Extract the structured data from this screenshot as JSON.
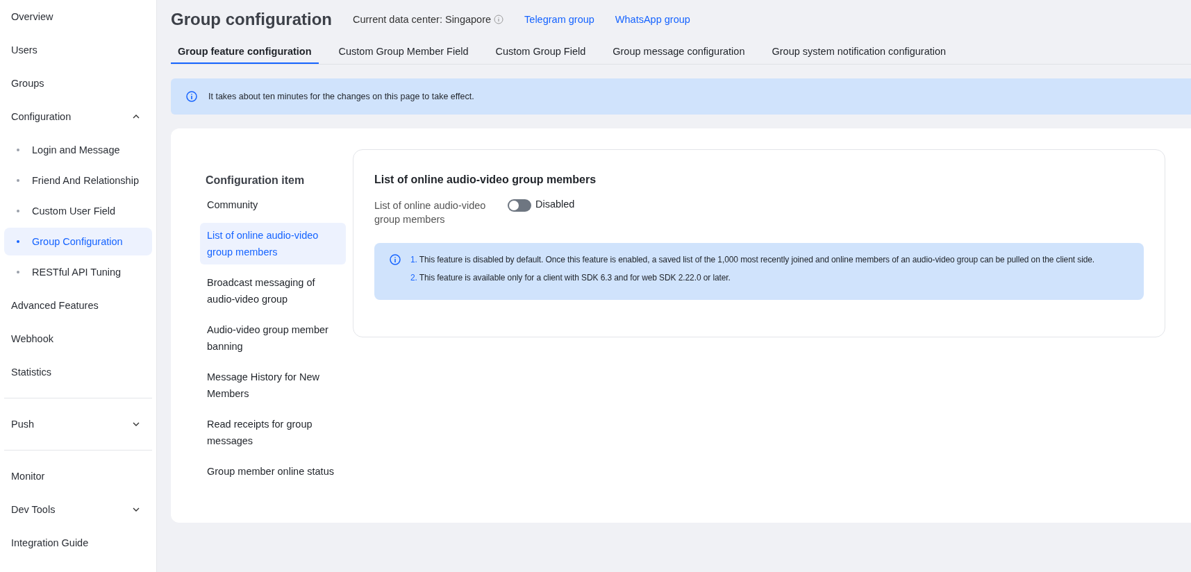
{
  "sidebar": {
    "items": [
      {
        "label": "Overview",
        "kind": "item"
      },
      {
        "label": "Users",
        "kind": "item"
      },
      {
        "label": "Groups",
        "kind": "item"
      },
      {
        "label": "Configuration",
        "kind": "group",
        "expanded": true,
        "children": [
          {
            "label": "Login and Message",
            "selected": false
          },
          {
            "label": "Friend And Relationship",
            "selected": false
          },
          {
            "label": "Custom User Field",
            "selected": false
          },
          {
            "label": "Group Configuration",
            "selected": true
          },
          {
            "label": "RESTful API Tuning",
            "selected": false
          }
        ]
      },
      {
        "label": "Advanced Features",
        "kind": "item"
      },
      {
        "label": "Webhook",
        "kind": "item"
      },
      {
        "label": "Statistics",
        "kind": "item"
      },
      {
        "kind": "divider"
      },
      {
        "label": "Push",
        "kind": "group",
        "expanded": false
      },
      {
        "kind": "divider"
      },
      {
        "label": "Monitor",
        "kind": "item"
      },
      {
        "label": "Dev Tools",
        "kind": "group",
        "expanded": false
      },
      {
        "label": "Integration Guide",
        "kind": "item"
      }
    ]
  },
  "header": {
    "title": "Group configuration",
    "data_center": "Current data center: Singapore",
    "links": [
      "Telegram group",
      "WhatsApp group"
    ]
  },
  "tabs": [
    {
      "label": "Group feature configuration",
      "selected": true
    },
    {
      "label": "Custom Group Member Field",
      "selected": false
    },
    {
      "label": "Custom Group Field",
      "selected": false
    },
    {
      "label": "Group message configuration",
      "selected": false
    },
    {
      "label": "Group system notification configuration",
      "selected": false
    }
  ],
  "notice": "It takes about ten minutes for the changes on this page to take effect.",
  "config_list": {
    "title": "Configuration item",
    "items": [
      {
        "label": "Community",
        "selected": false
      },
      {
        "label": "List of online audio-video group members",
        "selected": true
      },
      {
        "label": "Broadcast messaging of audio-video group",
        "selected": false
      },
      {
        "label": "Audio-video group member banning",
        "selected": false
      },
      {
        "label": "Message History for New Members",
        "selected": false
      },
      {
        "label": "Read receipts for group messages",
        "selected": false
      },
      {
        "label": "Group member online status",
        "selected": false
      }
    ]
  },
  "panel": {
    "title": "List of online audio-video group members",
    "setting": {
      "label": "List of online audio-video group members",
      "on": false,
      "status": "Disabled"
    },
    "notes": [
      {
        "number": "1.",
        "text": "This feature is disabled by default. Once this feature is enabled, a saved list of the 1,000 most recently joined and online members of an audio-video group can be pulled on the client side."
      },
      {
        "number": "2.",
        "text": "This feature is available only for a client with SDK 6.3 and for web SDK 2.22.0 or later."
      }
    ]
  }
}
